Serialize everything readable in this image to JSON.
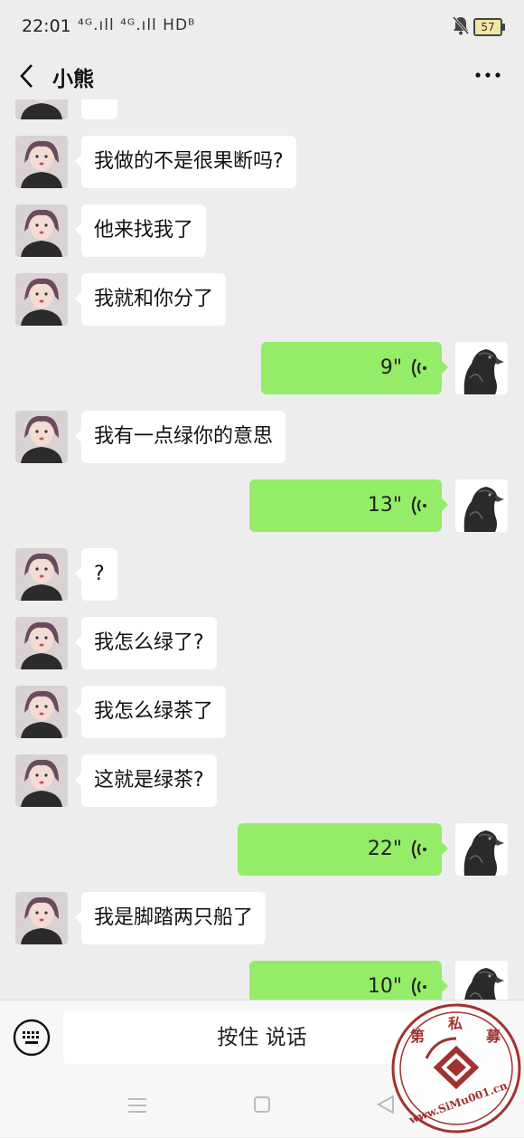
{
  "status_bar": {
    "time": "22:01",
    "signal": "⁴ᴳ.ıll ⁴ᴳ.ıll HDᴮ",
    "battery": "57"
  },
  "header": {
    "title": "小熊"
  },
  "messages": [
    {
      "side": "left",
      "text": ""
    },
    {
      "side": "left",
      "text": "我做的不是很果断吗?"
    },
    {
      "side": "left",
      "text": "他来找我了"
    },
    {
      "side": "left",
      "text": "我就和你分了"
    },
    {
      "side": "right",
      "type": "voice",
      "duration": "9\""
    },
    {
      "side": "left",
      "text": "我有一点绿你的意思"
    },
    {
      "side": "right",
      "type": "voice",
      "duration": "13\""
    },
    {
      "side": "left",
      "text": "?"
    },
    {
      "side": "left",
      "text": "我怎么绿了?"
    },
    {
      "side": "left",
      "text": "我怎么绿茶了"
    },
    {
      "side": "left",
      "text": "这就是绿茶?"
    },
    {
      "side": "right",
      "type": "voice",
      "duration": "22\""
    },
    {
      "side": "left",
      "text": "我是脚踏两只船了"
    },
    {
      "side": "right",
      "type": "voice",
      "duration": "10\""
    }
  ],
  "input_bar": {
    "hold_to_talk": "按住 说话"
  },
  "watermark": {
    "chars": [
      "第",
      "私",
      "募"
    ],
    "site": "www.SiMu001.cn"
  },
  "colors": {
    "background": "#ededed",
    "sent_bubble": "#95ec69",
    "received_bubble": "#ffffff"
  }
}
